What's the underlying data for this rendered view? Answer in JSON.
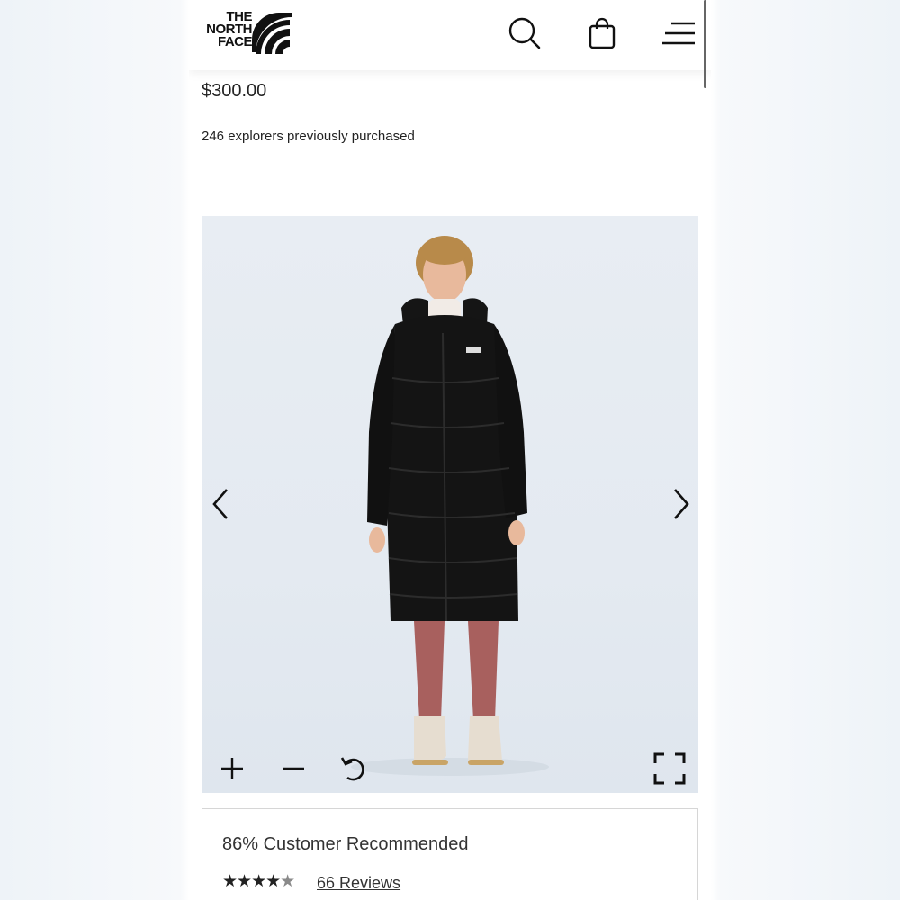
{
  "brand": {
    "logo_line1": "THE",
    "logo_line2": "NORTH",
    "logo_line3": "FACE"
  },
  "header": {
    "icons": [
      "search-icon",
      "shopping-bag-icon",
      "menu-icon"
    ]
  },
  "product": {
    "price": "$300.00",
    "purchased_text": "246 explorers previously purchased"
  },
  "gallery": {
    "controls": [
      "chevron-left-icon",
      "chevron-right-icon",
      "zoom-in-icon",
      "zoom-out-icon",
      "rotate-icon",
      "fullscreen-icon"
    ]
  },
  "reviews": {
    "recommended": "86% Customer Recommended",
    "rating": 4.5,
    "stars_full": "★★★★",
    "stars_partial": "★",
    "reviews_link": "66 Reviews"
  },
  "colors": {
    "accent": "#111111",
    "background": "#ffffff",
    "image_backdrop": "#e6ecf2",
    "jacket": "#141414",
    "leggings": "#a8605e"
  }
}
